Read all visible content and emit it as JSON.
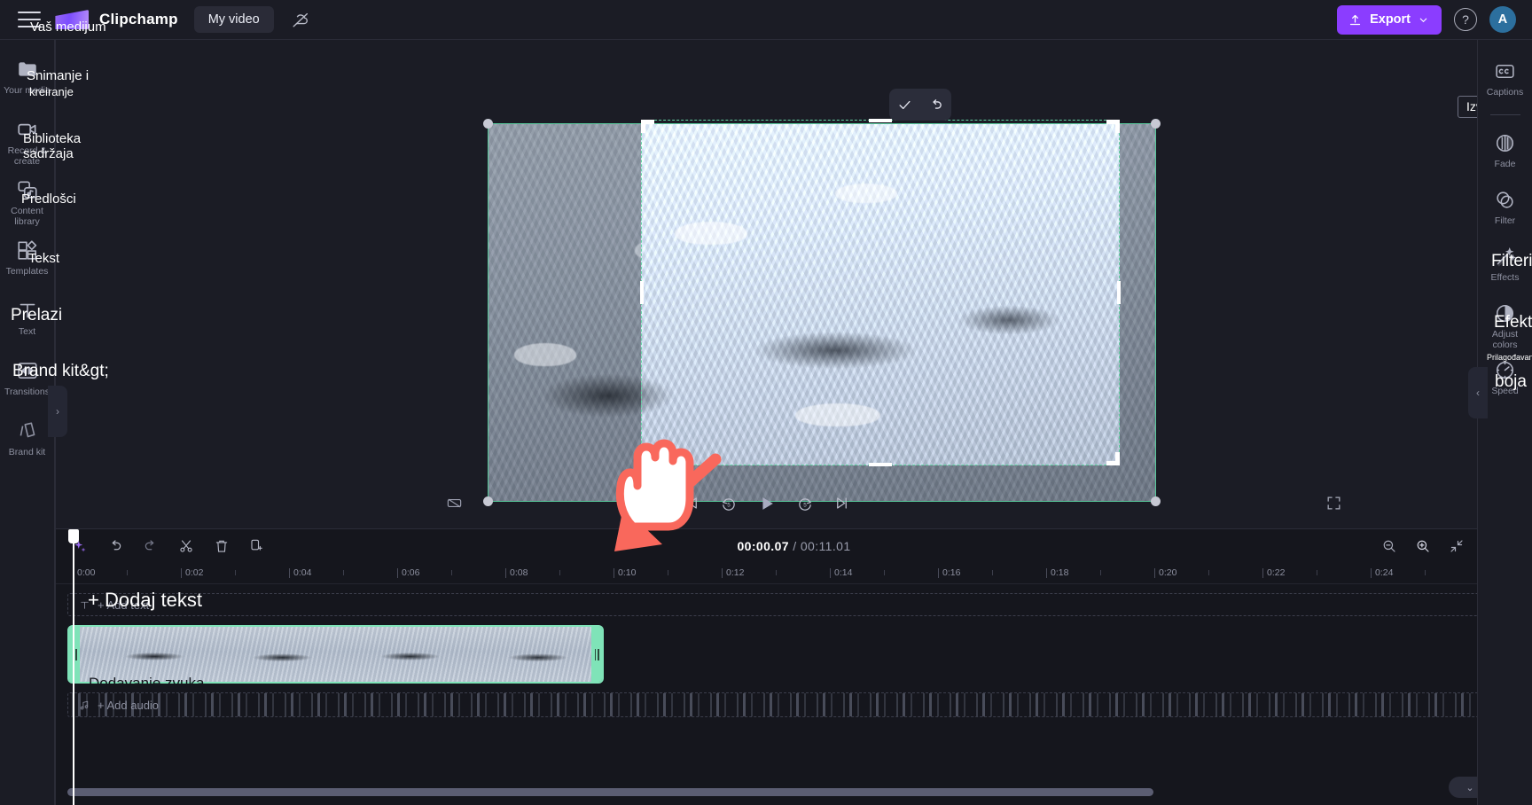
{
  "app": {
    "brand": "Clipchamp",
    "project_tab": "My video"
  },
  "header": {
    "export_label": "Export",
    "help_glyph": "?",
    "avatar_initial": "A",
    "accent_color": "#8b3dff"
  },
  "left_sidebar": {
    "items": [
      {
        "label": "Your media",
        "icon": "folder-icon",
        "translation": "Snimanje i",
        "translation2": "kreiranje"
      },
      {
        "label": "Record & create",
        "icon": "video-camera-icon",
        "translation": "Biblioteka",
        "translation2": "sadržaja"
      },
      {
        "label": "Content library",
        "icon": "content-library-icon",
        "translation": "Predlošci",
        "translation2": ""
      },
      {
        "label": "Templates",
        "icon": "templates-icon",
        "translation": "Tekst",
        "translation2": ""
      },
      {
        "label": "Text",
        "icon": "text-icon",
        "translation": "Prelazi",
        "translation2": ""
      },
      {
        "label": "Transitions",
        "icon": "transitions-icon",
        "translation": "Brand kit&gt;",
        "translation2": ""
      },
      {
        "label": "Brand kit",
        "icon": "brand-kit-icon",
        "translation": "",
        "translation2": ""
      }
    ],
    "collapse_glyph": "›"
  },
  "right_sidebar": {
    "items": [
      {
        "label": "Captions",
        "icon": "captions-icon",
        "translation": ""
      },
      {
        "label": "Fade",
        "icon": "fade-icon",
        "translation": ""
      },
      {
        "label": "Filter",
        "icon": "filter-icon",
        "translation": "Filteri"
      },
      {
        "label": "Effects",
        "icon": "effects-wand-icon",
        "translation": "Efekti"
      },
      {
        "label": "Adjust colors",
        "icon": "adjust-colors-icon",
        "translation": "Prilagođavanje"
      },
      {
        "label": "Speed",
        "icon": "speed-gauge-icon",
        "translation": "boja"
      }
    ],
    "collapse_glyph": "‹"
  },
  "preview": {
    "crop_confirm": "confirm-check-icon",
    "crop_reset": "undo-icon",
    "export_tooltip": "Izvezi",
    "export_tooltip_suffix": "›",
    "selection_color": "#57c79a",
    "crop_border_color": "#62d4a4",
    "mute_icon": "mute-icon",
    "skip_start_icon": "skip-to-start-icon",
    "back5_icon": "rewind-5-icon",
    "play_icon": "play-icon",
    "fwd5_icon": "forward-5-icon",
    "skip_end_icon": "skip-to-end-icon",
    "fullscreen_icon": "fullscreen-icon",
    "collapse_glyph": "⌄"
  },
  "timeline": {
    "tools": [
      {
        "name": "ai-sparkle-icon"
      },
      {
        "name": "undo-icon"
      },
      {
        "name": "redo-icon"
      },
      {
        "name": "split-scissors-icon"
      },
      {
        "name": "delete-trash-icon"
      },
      {
        "name": "duplicate-icon"
      }
    ],
    "current_time": "00:00.07",
    "separator": "/",
    "total_time": "00:11.01",
    "zoom_tools": [
      {
        "name": "zoom-out-icon"
      },
      {
        "name": "zoom-in-icon"
      },
      {
        "name": "fit-timeline-icon"
      }
    ],
    "ruler_labels": [
      "0:00",
      "0:02",
      "0:04",
      "0:06",
      "0:08",
      "0:10",
      "0:12",
      "0:14",
      "0:16",
      "0:18",
      "0:20",
      "0:22",
      "0:24"
    ],
    "add_text_label": "+ Add text",
    "add_audio_label": "+ Add audio",
    "clip_name_overlay": "Dodavanje zvuka",
    "add_text_overlay": "+ Dodaj tekst",
    "clip_border_color": "#7fe3b8"
  },
  "overlays": {
    "media_top": "Vaš medijum"
  }
}
